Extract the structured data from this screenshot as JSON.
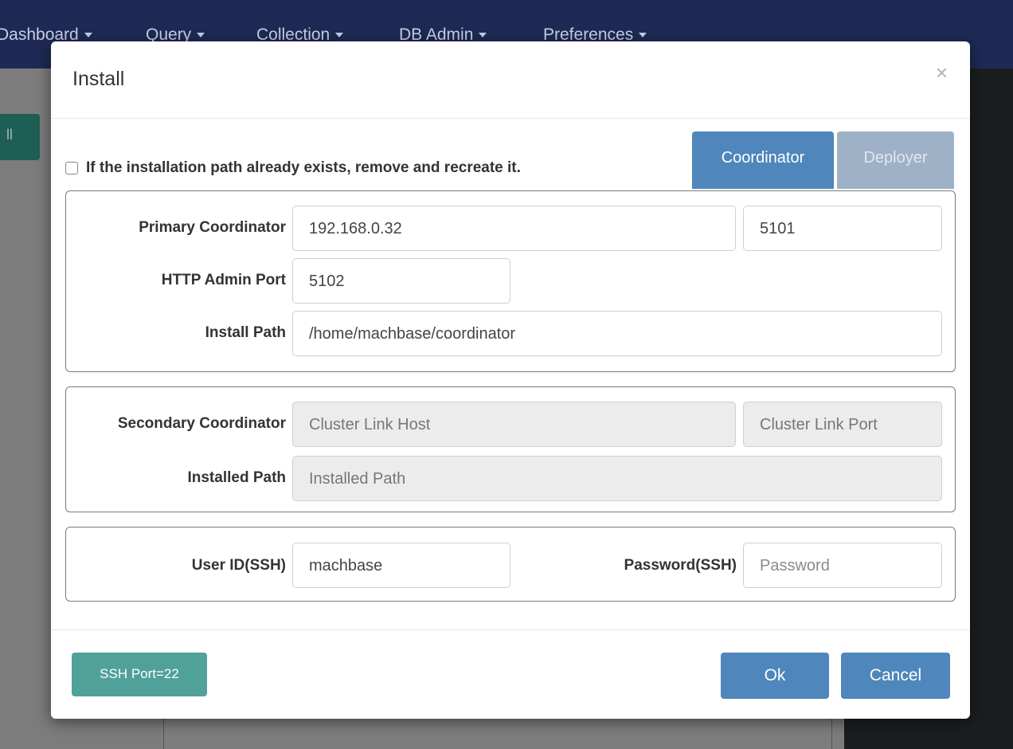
{
  "nav": {
    "items": [
      {
        "label": "Dashboard"
      },
      {
        "label": "Query"
      },
      {
        "label": "Collection"
      },
      {
        "label": "DB Admin"
      },
      {
        "label": "Preferences"
      }
    ]
  },
  "background": {
    "teal_button_label": "ll"
  },
  "modal": {
    "title": "Install",
    "close_glyph": "×",
    "recreate_label": "If the installation path already exists, remove and recreate it.",
    "tabs": [
      {
        "label": "Coordinator",
        "active": true
      },
      {
        "label": "Deployer",
        "active": false
      }
    ],
    "primary": {
      "label": "Primary Coordinator",
      "host": "192.168.0.32",
      "port": "5101",
      "http_admin_label": "HTTP Admin Port",
      "http_admin_port": "5102",
      "install_path_label": "Install Path",
      "install_path": "/home/machbase/coordinator"
    },
    "secondary": {
      "label": "Secondary Coordinator",
      "host_placeholder": "Cluster Link Host",
      "port_placeholder": "Cluster Link Port",
      "installed_path_label": "Installed Path",
      "installed_path_placeholder": "Installed Path"
    },
    "ssh": {
      "user_label": "User ID(SSH)",
      "user_value": "machbase",
      "password_label": "Password(SSH)",
      "password_placeholder": "Password"
    },
    "footer": {
      "ssh_port_label": "SSH Port=22",
      "ok_label": "Ok",
      "cancel_label": "Cancel"
    }
  },
  "colors": {
    "navbar": "#1e2a55",
    "primary_button": "#4f86bb",
    "ssh_button": "#4fa19a",
    "inactive_tab": "#9fb1c6"
  }
}
